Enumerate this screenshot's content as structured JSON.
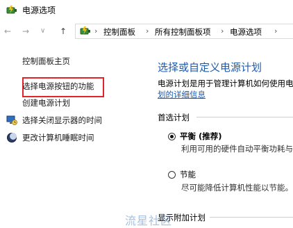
{
  "window": {
    "title": "电源选项"
  },
  "address_bar": {
    "crumbs": [
      "控制面板",
      "所有控制面板项",
      "电源选项"
    ]
  },
  "sidebar": {
    "home": "控制面板主页",
    "items": [
      {
        "label": "选择电源按钮的功能",
        "icon": "none"
      },
      {
        "label": "创建电源计划",
        "icon": "none"
      },
      {
        "label": "选择关闭显示器的时间",
        "icon": "monitor-clock-icon"
      },
      {
        "label": "更改计算机睡眠时间",
        "icon": "moon-icon"
      }
    ]
  },
  "main": {
    "title": "选择或自定义电源计划",
    "description": "电源计划是用于管理计算机如何使用电",
    "description_link": "划的详细信息",
    "preferred_plans_label": "首选计划",
    "plans": [
      {
        "name": "平衡 (推荐)",
        "desc": "利用可用的硬件自动平衡功耗与",
        "selected": true
      },
      {
        "name": "节能",
        "desc": "尽可能降低计算机性能以节能。",
        "selected": false
      }
    ],
    "extra_plans_label": "显示附加计划"
  },
  "watermark": "流星社区",
  "colors": {
    "link_blue": "#1e5aa8",
    "highlight_red": "#e0242a"
  }
}
